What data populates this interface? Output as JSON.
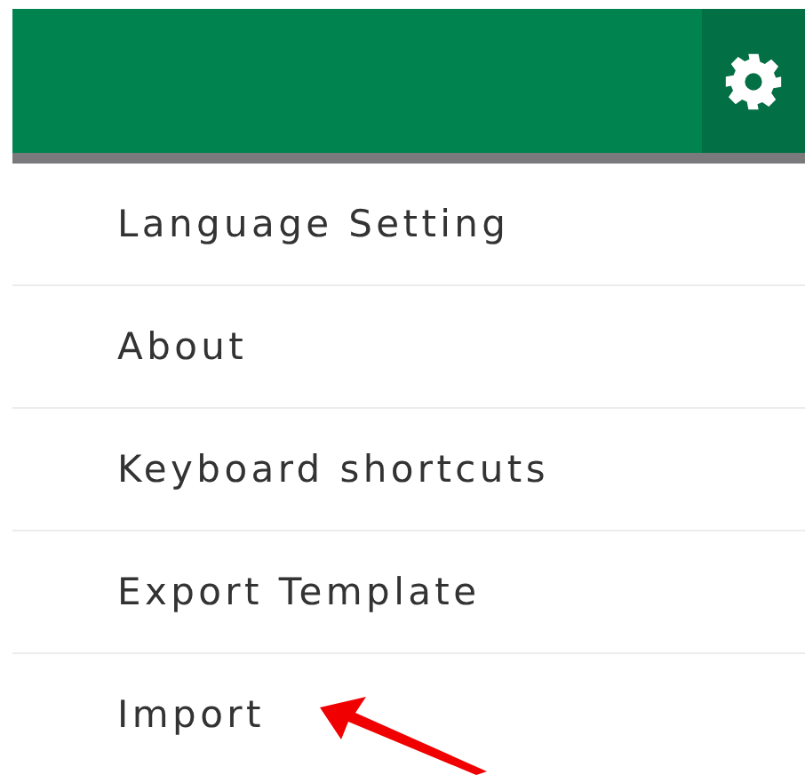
{
  "menu": [
    {
      "label": "Language Setting"
    },
    {
      "label": "About"
    },
    {
      "label": "Keyboard shortcuts"
    },
    {
      "label": "Export Template"
    },
    {
      "label": "Import"
    }
  ]
}
